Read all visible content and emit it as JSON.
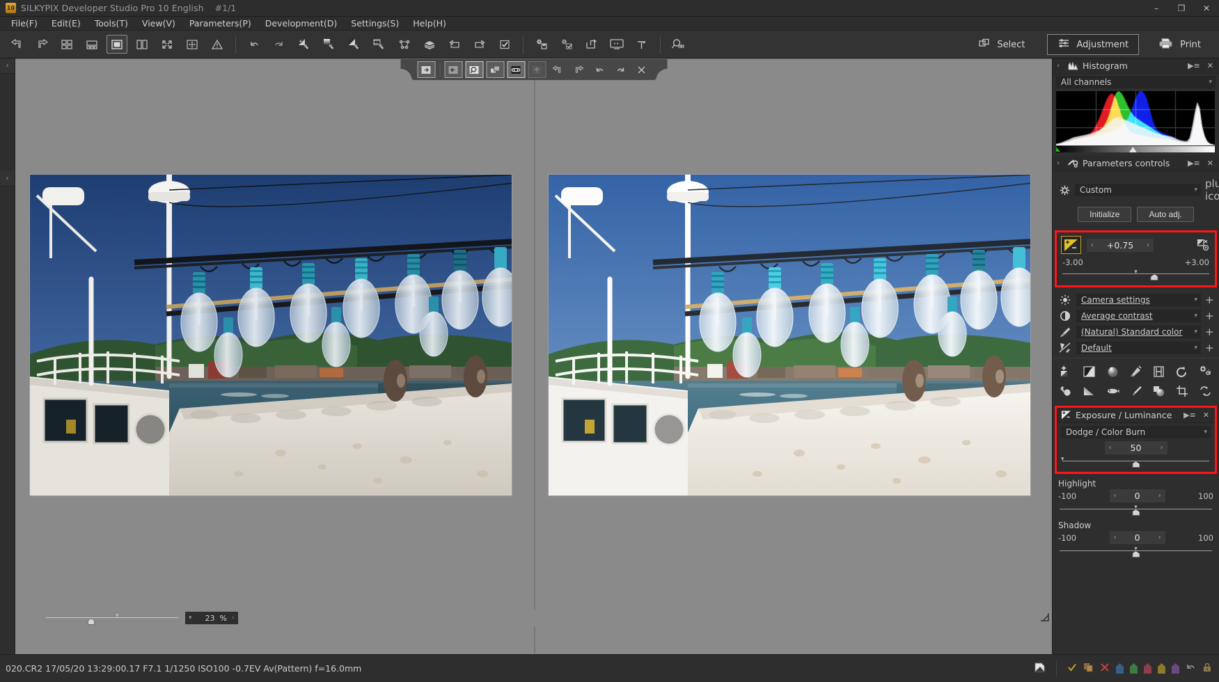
{
  "window": {
    "title": "SILKYPIX Developer Studio Pro 10 English",
    "counter": "#1/1",
    "logo_text": "10",
    "minimize": "–",
    "maximize": "❐",
    "close": "✕"
  },
  "menu": [
    {
      "label": "File(F)",
      "text": "File(",
      "key": "F"
    },
    {
      "label": "Edit(E)",
      "text": "Edit(",
      "key": "E"
    },
    {
      "label": "Tools(T)",
      "text": "Tools(",
      "key": "T"
    },
    {
      "label": "View(V)",
      "text": "View(",
      "key": "V"
    },
    {
      "label": "Parameters(P)",
      "text": "Parameters(",
      "key": "P"
    },
    {
      "label": "Development(D)",
      "text": "Development(",
      "key": "D"
    },
    {
      "label": "Settings(S)",
      "text": "Settings(",
      "key": "S"
    },
    {
      "label": "Help(H)",
      "text": "Help(",
      "key": "H"
    }
  ],
  "toolbar": {
    "icons": [
      "previous-image-icon",
      "next-image-icon",
      "thumbnail-grid-icon",
      "filmstrip-view-icon",
      "single-view-icon",
      "compare-view-icon",
      "fullscreen-icon",
      "multi-view-icon",
      "warning-icon",
      "undo-icon",
      "redo-icon",
      "exposure-brush-icon",
      "gradient-brush-icon",
      "tone-brush-icon",
      "spot-brush-icon",
      "mesh-transform-icon",
      "layers-icon",
      "rotate-left-icon",
      "rotate-right-icon",
      "checkmark-box-icon",
      "save-settings-icon",
      "apply-settings-icon",
      "export-icon",
      "slideshow-icon",
      "flag-marker-icon",
      "search-zoom-icon"
    ],
    "select_label": "Select",
    "adjustment_label": "Adjustment",
    "print_label": "Print"
  },
  "overlay_toolbar": {
    "icons": [
      "expand-panel-icon",
      "collapse-panel-icon",
      "magnifier-icon",
      "compare-overlay-icon",
      "link-panes-icon",
      "reset-compare-icon",
      "step-back-icon",
      "step-forward-icon",
      "undo-icon",
      "redo-icon",
      "close-icon"
    ]
  },
  "left_rail": {
    "tabs": [
      "›",
      "›"
    ]
  },
  "viewer": {
    "zoom_value": "23",
    "zoom_unit": "%"
  },
  "histogram_panel": {
    "title": "Histogram",
    "icon": "histogram-icon",
    "channel_select": "All channels",
    "menu_icon": "panel-menu-icon",
    "close_icon": "close-icon"
  },
  "chart_data": {
    "type": "area",
    "title": "Histogram",
    "xlabel": "",
    "ylabel": "",
    "legend": [
      "All channels"
    ],
    "grid": true,
    "xlim": [
      0,
      255
    ],
    "ylim": [
      0,
      100
    ],
    "series": [
      {
        "name": "Red",
        "color": "#e01b24",
        "values": [
          2,
          3,
          4,
          5,
          6,
          8,
          10,
          12,
          13,
          14,
          15,
          16,
          18,
          20,
          24,
          30,
          38,
          48,
          60,
          72,
          84,
          92,
          96,
          93,
          84,
          70,
          56,
          44,
          34,
          28,
          24,
          22,
          21,
          20,
          19,
          18,
          17,
          16,
          15,
          14,
          14,
          13,
          13,
          12,
          12,
          11,
          10,
          9,
          8,
          7,
          6,
          5,
          5,
          8,
          20,
          46,
          72,
          62,
          30,
          14,
          6,
          3,
          2,
          1
        ]
      },
      {
        "name": "Green",
        "color": "#2ec12e",
        "values": [
          2,
          3,
          4,
          5,
          6,
          7,
          9,
          11,
          12,
          13,
          14,
          15,
          16,
          17,
          18,
          20,
          23,
          26,
          30,
          36,
          44,
          56,
          72,
          88,
          98,
          100,
          96,
          88,
          78,
          68,
          60,
          54,
          50,
          47,
          44,
          41,
          38,
          35,
          32,
          29,
          26,
          23,
          20,
          18,
          16,
          14,
          12,
          10,
          8,
          7,
          6,
          5,
          5,
          8,
          22,
          48,
          74,
          64,
          32,
          15,
          6,
          3,
          2,
          1
        ]
      },
      {
        "name": "Blue",
        "color": "#1020e8",
        "values": [
          2,
          3,
          4,
          5,
          6,
          7,
          8,
          9,
          10,
          11,
          12,
          13,
          14,
          15,
          16,
          17,
          18,
          19,
          20,
          21,
          22,
          24,
          26,
          28,
          30,
          33,
          36,
          40,
          46,
          54,
          66,
          80,
          92,
          100,
          100,
          96,
          86,
          70,
          52,
          38,
          30,
          26,
          24,
          22,
          20,
          18,
          16,
          13,
          10,
          8,
          7,
          6,
          6,
          10,
          26,
          52,
          76,
          66,
          34,
          16,
          7,
          3,
          2,
          1
        ]
      },
      {
        "name": "Luminance",
        "color": "#f2f2f2",
        "values": [
          3,
          4,
          5,
          7,
          9,
          11,
          13,
          15,
          16,
          17,
          18,
          19,
          20,
          21,
          22,
          24,
          26,
          28,
          31,
          34,
          38,
          42,
          46,
          50,
          52,
          52,
          50,
          48,
          46,
          44,
          42,
          40,
          38,
          36,
          34,
          32,
          30,
          28,
          26,
          24,
          22,
          21,
          20,
          19,
          18,
          17,
          16,
          14,
          12,
          10,
          9,
          8,
          8,
          14,
          34,
          60,
          80,
          70,
          36,
          18,
          8,
          4,
          2,
          1
        ]
      }
    ],
    "marker_position_pct": 46
  },
  "parameters_panel": {
    "title": "Parameters controls",
    "icon": "parameters-controls-icon",
    "menu_icon": "panel-menu-icon",
    "close_icon": "close-icon",
    "preset_label": "Custom",
    "preset_icon": "gear-icon",
    "add_icon": "plus-icon",
    "initialize_label": "Initialize",
    "auto_adj_label": "Auto adj."
  },
  "exposure_bias": {
    "icon": "exposure-bias-icon",
    "value": "+0.75",
    "min": "-3.00",
    "max": "+3.00",
    "left_arrow": "‹",
    "right_arrow": "›",
    "aux_icon": "exposure-auto-icon",
    "thumb_pct": 62.5,
    "default_caret_pct": 50,
    "highlight_color": "#ff1417"
  },
  "dropdowns": [
    {
      "icon": "brightness-icon",
      "label": "Camera settings",
      "plus": "+"
    },
    {
      "icon": "contrast-icon",
      "label": "Average contrast",
      "plus": "+"
    },
    {
      "icon": "color-picker-icon",
      "label": "(Natural) Standard color",
      "plus": "+"
    },
    {
      "icon": "sharpness-icon",
      "label": "Default",
      "plus": "+"
    }
  ],
  "tool_icons": [
    "white-balance-icon",
    "tone-curve-icon",
    "highlight-controller-icon",
    "color-adjust-icon",
    "noise-reduction-icon",
    "lens-aberration-icon",
    "effects-icon",
    "dodge-burn-icon",
    "gradation-icon",
    "fisheye-icon",
    "brush-icon",
    "sphere-shading-icon",
    "crop-icon",
    "rotation-icon"
  ],
  "exposure_luminance_panel": {
    "title": "Exposure / Luminance",
    "icon": "exposure-luminance-icon",
    "menu_icon": "panel-menu-icon",
    "close_icon": "close-icon",
    "mode_select": "Dodge / Color Burn",
    "mode_value": "50",
    "mode_thumb_pct": 50,
    "mode_caret_pct": 1,
    "highlight_color": "#ff1417",
    "sliders": [
      {
        "name": "Highlight",
        "min": "-100",
        "max": "100",
        "value": "0",
        "thumb_pct": 50,
        "caret_pct": 50
      },
      {
        "name": "Shadow",
        "min": "-100",
        "max": "100",
        "value": "0",
        "thumb_pct": 50,
        "caret_pct": 50
      }
    ]
  },
  "status_bar": {
    "text": "020.CR2 17/05/20 13:29:00.17 F7.1 1/1250 ISO100 -0.7EV Av(Pattern) f=16.0mm",
    "icons": [
      "raw-file-icon",
      "check-mark-icon",
      "copy-icon",
      "delete-icon",
      "tag-blue-icon",
      "tag-green-icon",
      "tag-red-icon",
      "tag-yellow-icon",
      "tag-purple-icon",
      "undo-icon",
      "lock-icon"
    ],
    "tag_colors": [
      "#3a5f86",
      "#3d7a45",
      "#8d3f4c",
      "#8e7a2c",
      "#6a4a7e"
    ],
    "check_color": "#c0a227",
    "delete_color": "#c0423c"
  }
}
